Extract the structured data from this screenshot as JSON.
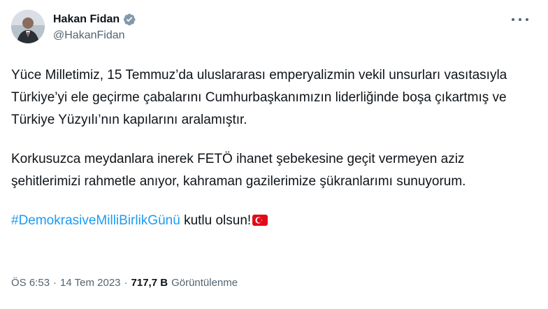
{
  "author": {
    "display_name": "Hakan Fidan",
    "handle": "@HakanFidan",
    "verified_icon": "verified-badge-icon",
    "avatar": "profile-photo"
  },
  "more_icon": "more-options-icon",
  "tweet": {
    "paragraph1": "Yüce Milletimiz, 15 Temmuz’da uluslararası emperyalizmin vekil unsurları vasıtasıyla Türkiye’yi ele geçirme çabalarını Cumhurbaşkanımızın liderliğinde boşa çıkartmış ve Türkiye Yüzyılı’nın kapılarını aralamıştır.",
    "paragraph2": "Korkusuzca meydanlara inerek FETÖ ihanet şebekesine geçit vermeyen aziz şehitlerimizi rahmetle anıyor, kahraman gazilerimize şükranlarımı sunuyorum.",
    "hashtag": "#DemokrasiveMilliBirlikGünü",
    "tail_text": " kutlu olsun!",
    "emoji": "turkey-flag-icon"
  },
  "meta": {
    "time": "ÖS 6:53",
    "separator": "·",
    "date": "14 Tem 2023",
    "views_count": "717,7 B",
    "views_label": "Görüntülenme"
  },
  "colors": {
    "text": "#0f1419",
    "secondary": "#536471",
    "link": "#1d9bf0",
    "verified": "#829aab",
    "flag": "#e30a17"
  }
}
